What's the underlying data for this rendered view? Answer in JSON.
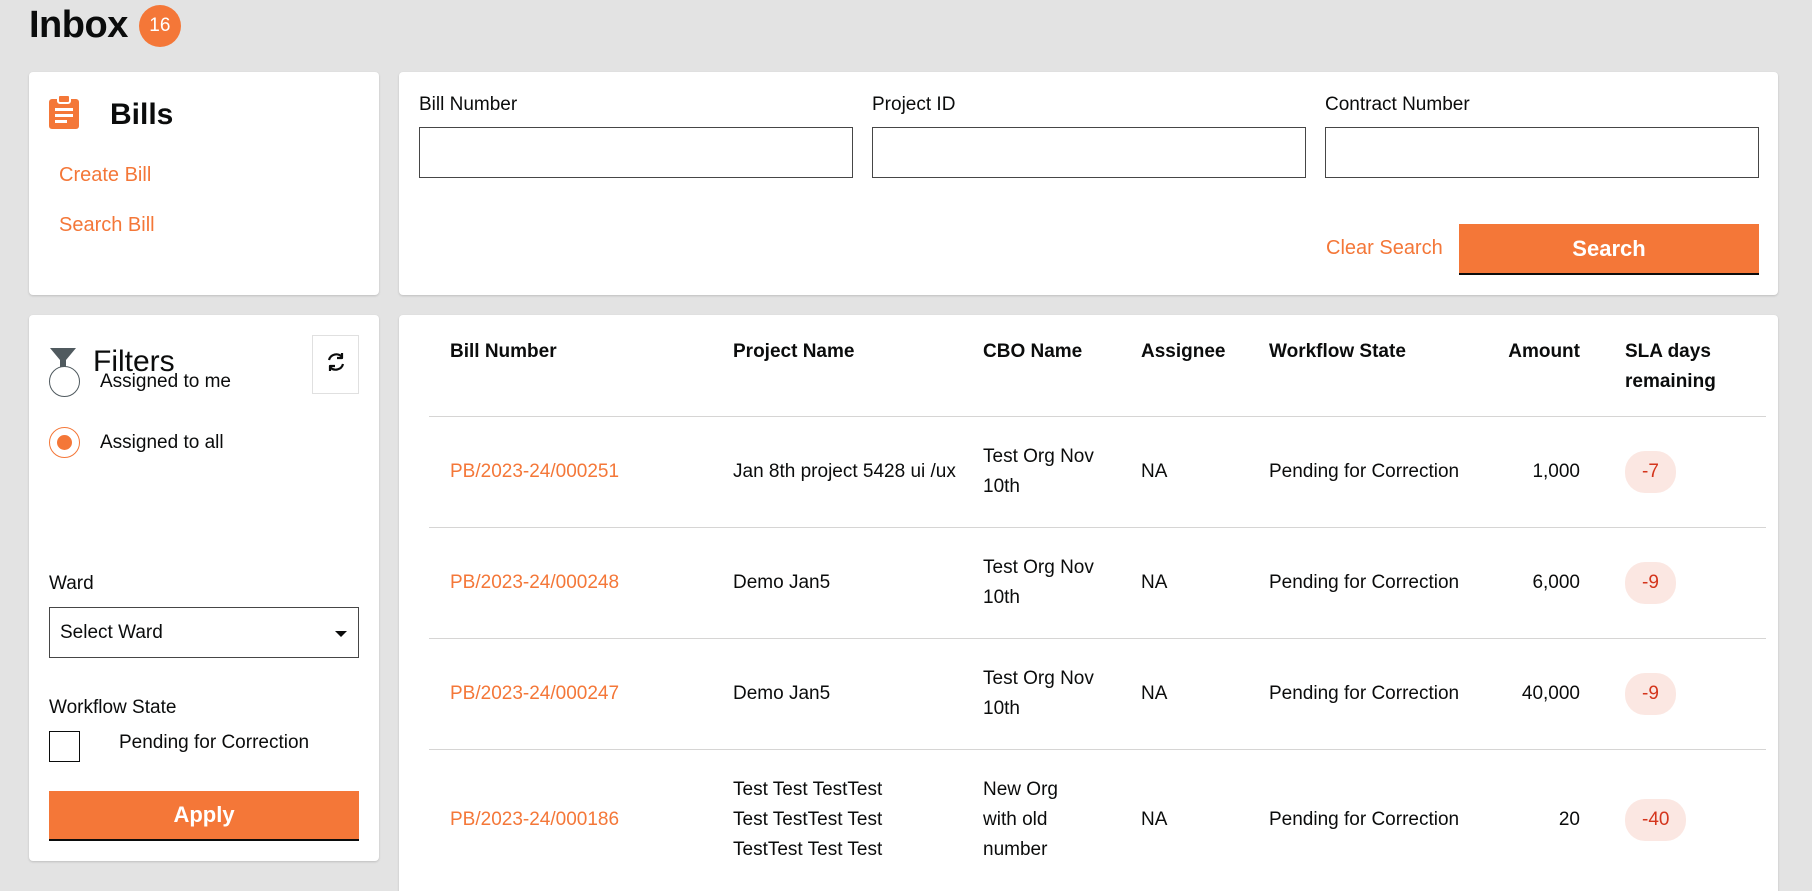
{
  "header": {
    "title": "Inbox",
    "count": "16"
  },
  "bills_card": {
    "title": "Bills",
    "links": {
      "create": "Create Bill",
      "search": "Search Bill"
    }
  },
  "search": {
    "fields": [
      {
        "label": "Bill Number",
        "value": ""
      },
      {
        "label": "Project ID",
        "value": ""
      },
      {
        "label": "Contract Number",
        "value": ""
      }
    ],
    "clear_label": "Clear Search",
    "search_label": "Search"
  },
  "filters": {
    "title": "Filters",
    "radio_options": [
      {
        "label": "Assigned to me",
        "checked": false
      },
      {
        "label": "Assigned to all",
        "checked": true
      }
    ],
    "ward_label": "Ward",
    "ward_selected": "Select Ward",
    "workflow_label": "Workflow State",
    "workflow_option": "Pending for Correction",
    "workflow_checked": false,
    "apply_label": "Apply"
  },
  "table": {
    "columns": [
      "Bill Number",
      "Project Name",
      "CBO Name",
      "Assignee",
      "Workflow State",
      "Amount",
      "SLA days remaining"
    ],
    "rows": [
      {
        "bill_number": "PB/2023-24/000251",
        "project_name": "Jan 8th project 5428 ui /ux",
        "cbo_name": "Test Org Nov 10th",
        "assignee": "NA",
        "workflow_state": "Pending for Correction",
        "amount": "1,000",
        "sla": "-7"
      },
      {
        "bill_number": "PB/2023-24/000248",
        "project_name": "Demo Jan5",
        "cbo_name": "Test Org Nov 10th",
        "assignee": "NA",
        "workflow_state": "Pending for Correction",
        "amount": "6,000",
        "sla": "-9"
      },
      {
        "bill_number": "PB/2023-24/000247",
        "project_name": "Demo Jan5",
        "cbo_name": "Test Org Nov 10th",
        "assignee": "NA",
        "workflow_state": "Pending for Correction",
        "amount": "40,000",
        "sla": "-9"
      },
      {
        "bill_number": "PB/2023-24/000186",
        "project_name": "Test Test TestTest Test TestTest Test TestTest Test Test",
        "cbo_name": "New Org with old number",
        "assignee": "NA",
        "workflow_state": "Pending for Correction",
        "amount": "20",
        "sla": "-40"
      }
    ]
  },
  "colors": {
    "accent": "#f47738",
    "background": "#e3e3e3",
    "sla_bg": "#fbe7e2",
    "sla_text": "#d4351c"
  },
  "icons": {
    "bills": "clipboard-icon",
    "filters": "filter-funnel-icon",
    "refresh": "refresh-icon",
    "dropdown": "caret-down-icon"
  }
}
